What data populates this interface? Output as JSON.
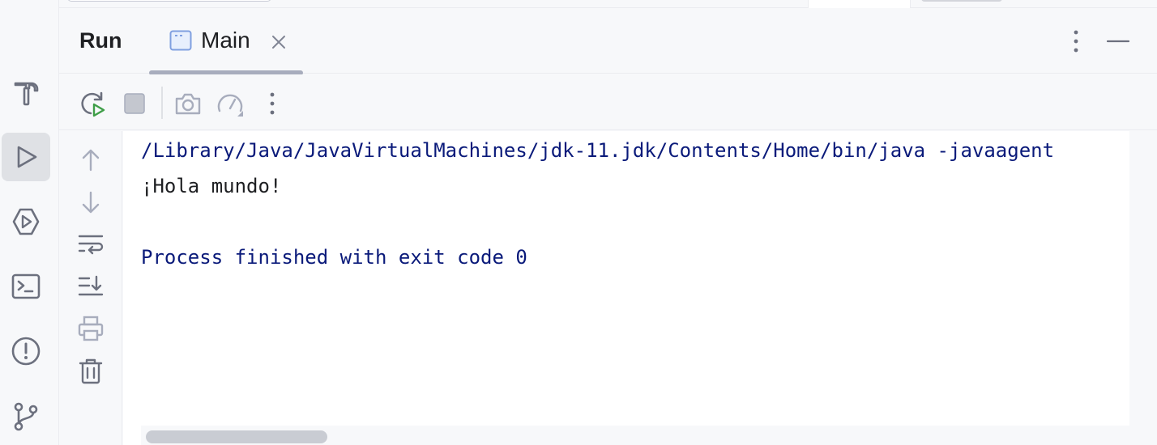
{
  "window": {
    "panel_title": "Run"
  },
  "tabs": [
    {
      "label": "Main",
      "icon": "application-icon",
      "active": true
    }
  ],
  "left_stripe": [
    {
      "icon": "build-hammer-icon",
      "active": false
    },
    {
      "icon": "run-icon",
      "active": true
    },
    {
      "icon": "services-icon",
      "active": false
    },
    {
      "icon": "terminal-icon",
      "active": false
    },
    {
      "icon": "problems-icon",
      "active": false
    },
    {
      "icon": "git-branch-icon",
      "active": false
    }
  ],
  "toolbar": [
    {
      "icon": "rerun-icon",
      "enabled": true
    },
    {
      "icon": "stop-icon",
      "enabled": false
    },
    {
      "icon": "camera-icon",
      "enabled": false
    },
    {
      "icon": "profiler-gauge-icon",
      "enabled": false
    },
    {
      "icon": "more-vertical-icon",
      "enabled": true
    }
  ],
  "gutter": [
    {
      "icon": "arrow-up-icon"
    },
    {
      "icon": "arrow-down-icon"
    },
    {
      "icon": "soft-wrap-icon"
    },
    {
      "icon": "scroll-to-end-icon"
    },
    {
      "icon": "print-icon"
    },
    {
      "icon": "trash-icon"
    }
  ],
  "console": {
    "lines": [
      {
        "text": "/Library/Java/JavaVirtualMachines/jdk-11.jdk/Contents/Home/bin/java -javaagent",
        "kind": "system"
      },
      {
        "text": "¡Hola mundo!",
        "kind": "output"
      },
      {
        "text": "",
        "kind": "output"
      },
      {
        "text": "Process finished with exit code 0",
        "kind": "system"
      }
    ]
  },
  "colors": {
    "system_text": "#0a1a7a",
    "output_text": "#1e1f22",
    "run_green": "#3f9e48",
    "icon_gray": "#6c707e",
    "icon_disabled": "#a8adbd"
  }
}
